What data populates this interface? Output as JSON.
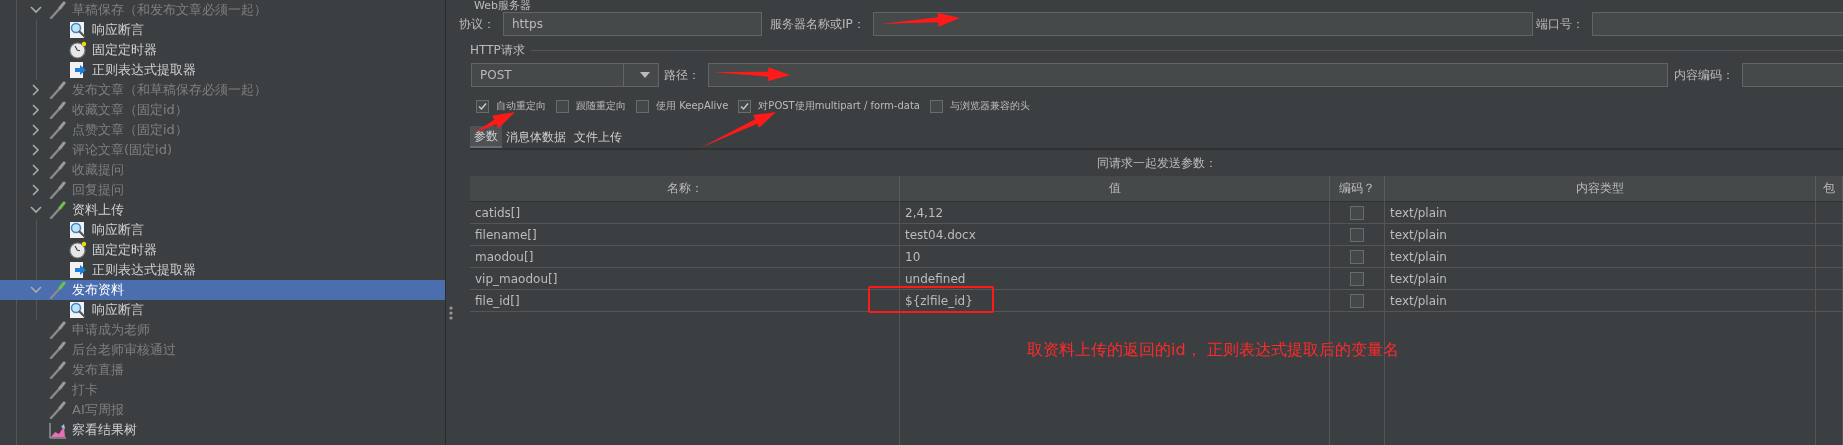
{
  "tree": [
    {
      "label": "草稿保存（和发布文章必须一起）",
      "kind": "sampler",
      "enabled": false,
      "expandable": true,
      "expanded": true,
      "selected": false,
      "children": [
        {
          "label": "响应断言",
          "kind": "assertion",
          "enabled": true,
          "expandable": false,
          "selected": false
        },
        {
          "label": "固定定时器",
          "kind": "timer",
          "enabled": true,
          "expandable": false,
          "selected": false
        },
        {
          "label": "正则表达式提取器",
          "kind": "extractor",
          "enabled": true,
          "expandable": false,
          "selected": false
        }
      ]
    },
    {
      "label": "发布文章（和草稿保存必须一起）",
      "kind": "sampler",
      "enabled": false,
      "expandable": true,
      "expanded": false,
      "selected": false
    },
    {
      "label": "收藏文章（固定id）",
      "kind": "sampler",
      "enabled": false,
      "expandable": true,
      "expanded": false,
      "selected": false
    },
    {
      "label": "点赞文章（固定id）",
      "kind": "sampler",
      "enabled": false,
      "expandable": true,
      "expanded": false,
      "selected": false
    },
    {
      "label": "评论文章(固定id)",
      "kind": "sampler",
      "enabled": false,
      "expandable": true,
      "expanded": false,
      "selected": false
    },
    {
      "label": "收藏提问",
      "kind": "sampler",
      "enabled": false,
      "expandable": true,
      "expanded": false,
      "selected": false
    },
    {
      "label": "回复提问",
      "kind": "sampler",
      "enabled": false,
      "expandable": true,
      "expanded": false,
      "selected": false
    },
    {
      "label": "资料上传",
      "kind": "sampler",
      "enabled": true,
      "expandable": true,
      "expanded": true,
      "selected": false,
      "children": [
        {
          "label": "响应断言",
          "kind": "assertion",
          "enabled": true,
          "expandable": false,
          "selected": false
        },
        {
          "label": "固定定时器",
          "kind": "timer",
          "enabled": true,
          "expandable": false,
          "selected": false
        },
        {
          "label": "正则表达式提取器",
          "kind": "extractor",
          "enabled": true,
          "expandable": false,
          "selected": false
        }
      ]
    },
    {
      "label": "发布资料",
      "kind": "sampler",
      "enabled": true,
      "expandable": true,
      "expanded": true,
      "selected": true,
      "children": [
        {
          "label": "响应断言",
          "kind": "assertion",
          "enabled": true,
          "expandable": false,
          "selected": false
        }
      ]
    },
    {
      "label": "申请成为老师",
      "kind": "sampler",
      "enabled": false,
      "expandable": false,
      "selected": false
    },
    {
      "label": "后台老师审核通过",
      "kind": "sampler",
      "enabled": false,
      "expandable": false,
      "selected": false
    },
    {
      "label": "发布直播",
      "kind": "sampler",
      "enabled": false,
      "expandable": false,
      "selected": false
    },
    {
      "label": "打卡",
      "kind": "sampler",
      "enabled": false,
      "expandable": false,
      "selected": false
    },
    {
      "label": "AI写周报",
      "kind": "sampler",
      "enabled": false,
      "expandable": false,
      "selected": false
    },
    {
      "label": "察看结果树",
      "kind": "listener",
      "enabled": true,
      "expandable": false,
      "selected": false
    }
  ],
  "web_server": {
    "legend": "Web服务器",
    "protocol_label": "协议：",
    "protocol": "https",
    "server_label": "服务器名称或IP：",
    "port_label": "端口号："
  },
  "http_request": {
    "legend": "HTTP请求",
    "method": "POST",
    "path_label": "路径：",
    "encoding_label": "内容编码："
  },
  "options": [
    {
      "label": "自动重定向",
      "checked": true
    },
    {
      "label": "跟随重定向",
      "checked": false
    },
    {
      "label": "使用 KeepAlive",
      "checked": false
    },
    {
      "label": "对POST使用multipart / form-data",
      "checked": true
    },
    {
      "label": "与浏览器兼容的头",
      "checked": false
    }
  ],
  "tabs": [
    {
      "label": "参数",
      "selected": true
    },
    {
      "label": "消息体数据",
      "selected": false
    },
    {
      "label": "文件上传",
      "selected": false
    }
  ],
  "params": {
    "caption": "同请求一起发送参数：",
    "columns": [
      "名称：",
      "值",
      "编码？",
      "内容类型",
      "包"
    ],
    "rows": [
      {
        "name": "catids[]",
        "value": "2,4,12",
        "encode": false,
        "content_type": "text/plain",
        "highlighted": false
      },
      {
        "name": "filename[]",
        "value": "test04.docx",
        "encode": false,
        "content_type": "text/plain",
        "highlighted": false
      },
      {
        "name": "maodou[]",
        "value": "10",
        "encode": false,
        "content_type": "text/plain",
        "highlighted": false
      },
      {
        "name": "vip_maodou[]",
        "value": "undefined",
        "encode": false,
        "content_type": "text/plain",
        "highlighted": false
      },
      {
        "name": "file_id[]",
        "value": "${zlfile_id}",
        "encode": false,
        "content_type": "text/plain",
        "highlighted": true
      }
    ]
  },
  "note": "取资料上传的返回的id， 正则表达式提取后的变量名"
}
